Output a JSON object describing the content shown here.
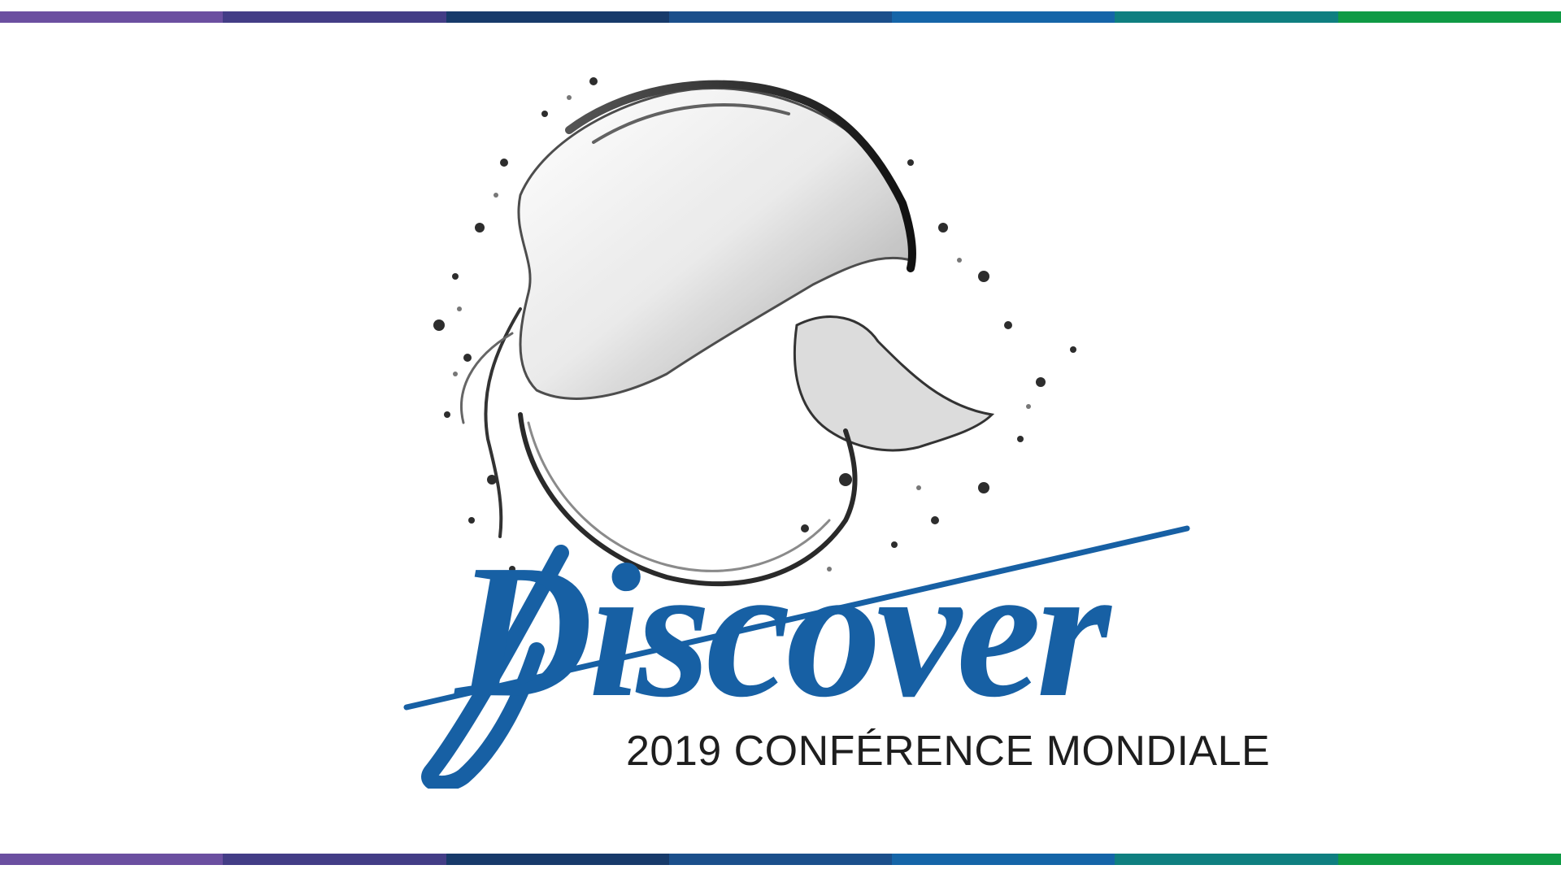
{
  "brand": {
    "wordmark": "Discover",
    "subtitle": "2019 CONFÉRENCE MONDIALE"
  },
  "colors": {
    "wordmark_blue": "#1760a4",
    "subtitle_text": "#1e1e1e",
    "stripe_segments": [
      "#6b4fa0",
      "#433d86",
      "#173a6a",
      "#1b4f8b",
      "#1565a8",
      "#0f7f80",
      "#0f9a45"
    ]
  },
  "imagery": {
    "splash_icon": "water-splash-icon"
  }
}
